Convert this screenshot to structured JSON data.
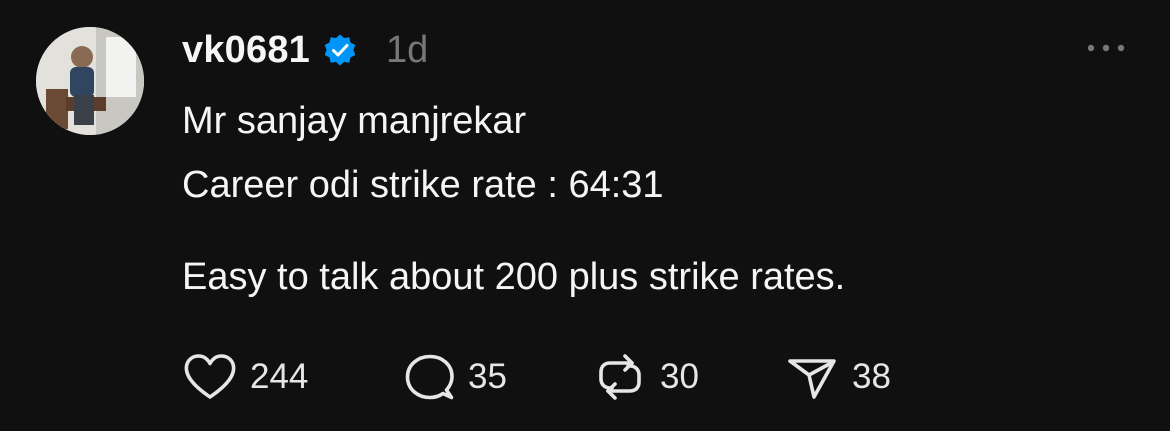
{
  "post": {
    "username": "vk0681",
    "verified": true,
    "time": "1d",
    "lines": [
      "Mr sanjay manjrekar",
      "Career odi strike rate : 64:31",
      "Easy to talk about 200 plus strike rates."
    ]
  },
  "actions": {
    "likes": "244",
    "replies": "35",
    "reposts": "30",
    "shares": "38"
  },
  "icons": {
    "verified": "verified-badge-icon",
    "more": "more-options-icon",
    "like": "heart-icon",
    "reply": "comment-bubble-icon",
    "repost": "repost-icon",
    "share": "send-icon"
  },
  "colors": {
    "background": "#101010",
    "text": "#f3f5f7",
    "muted": "#777777",
    "verified": "#0095f6"
  }
}
